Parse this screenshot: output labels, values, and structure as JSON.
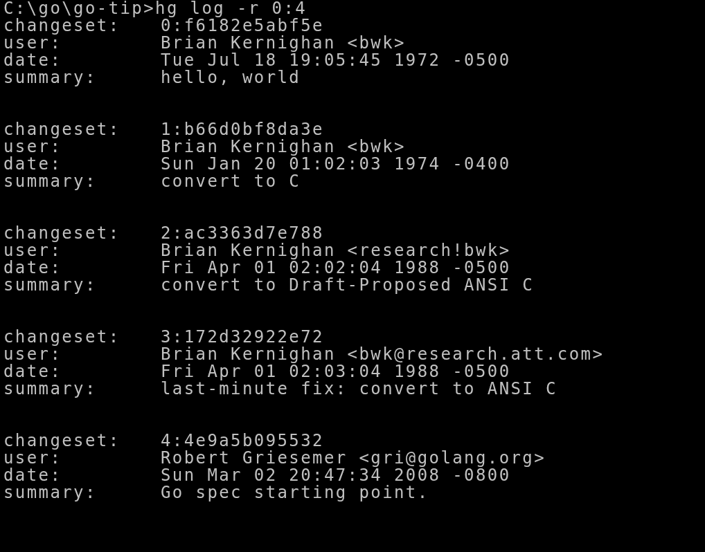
{
  "prompt": {
    "path": "C:\\go\\go-tip>",
    "command": "hg log -r 0:4"
  },
  "entries": [
    {
      "fields": [
        {
          "label": "changeset:",
          "value": "0:f6182e5abf5e"
        },
        {
          "label": "user:",
          "value": "Brian Kernighan <bwk>"
        },
        {
          "label": "date:",
          "value": "Tue Jul 18 19:05:45 1972 -0500"
        },
        {
          "label": "summary:",
          "value": "hello, world"
        }
      ]
    },
    {
      "fields": [
        {
          "label": "changeset:",
          "value": "1:b66d0bf8da3e"
        },
        {
          "label": "user:",
          "value": "Brian Kernighan <bwk>"
        },
        {
          "label": "date:",
          "value": "Sun Jan 20 01:02:03 1974 -0400"
        },
        {
          "label": "summary:",
          "value": "convert to C"
        }
      ]
    },
    {
      "fields": [
        {
          "label": "changeset:",
          "value": "2:ac3363d7e788"
        },
        {
          "label": "user:",
          "value": "Brian Kernighan <research!bwk>"
        },
        {
          "label": "date:",
          "value": "Fri Apr 01 02:02:04 1988 -0500"
        },
        {
          "label": "summary:",
          "value": "convert to Draft-Proposed ANSI C"
        }
      ]
    },
    {
      "fields": [
        {
          "label": "changeset:",
          "value": "3:172d32922e72"
        },
        {
          "label": "user:",
          "value": "Brian Kernighan <bwk@research.att.com>"
        },
        {
          "label": "date:",
          "value": "Fri Apr 01 02:03:04 1988 -0500"
        },
        {
          "label": "summary:",
          "value": "last-minute fix: convert to ANSI C"
        }
      ]
    },
    {
      "fields": [
        {
          "label": "changeset:",
          "value": "4:4e9a5b095532"
        },
        {
          "label": "user:",
          "value": "Robert Griesemer <gri@golang.org>"
        },
        {
          "label": "date:",
          "value": "Sun Mar 02 20:47:34 2008 -0800"
        },
        {
          "label": "summary:",
          "value": "Go spec starting point."
        }
      ]
    }
  ]
}
